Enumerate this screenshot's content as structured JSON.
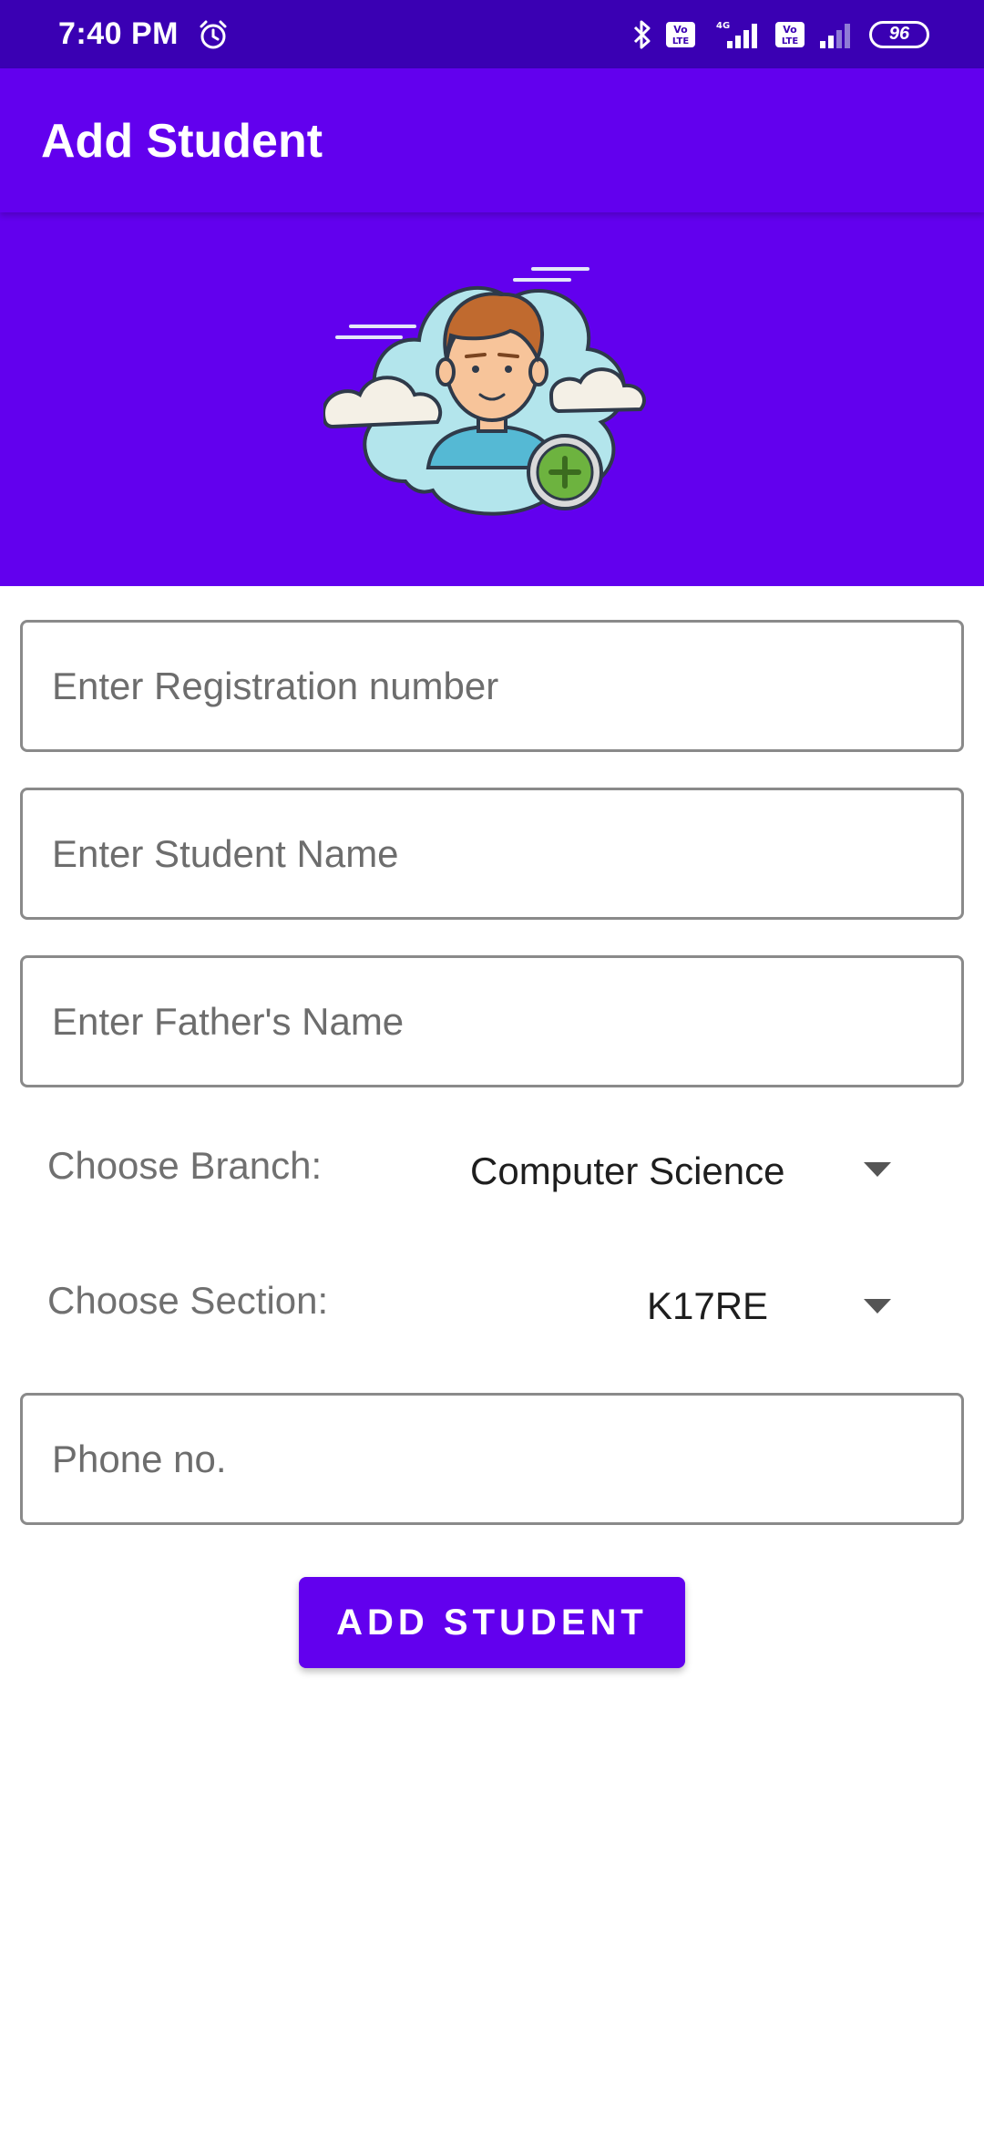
{
  "status_bar": {
    "time": "7:40 PM",
    "battery_level": "96",
    "icons": [
      "alarm-icon",
      "bluetooth-icon",
      "volte-icon",
      "signal-4g-icon",
      "volte-icon",
      "signal-icon",
      "battery-icon"
    ]
  },
  "app_bar": {
    "title": "Add Student"
  },
  "header": {
    "illustration": "student-avatar-add-icon"
  },
  "form": {
    "registration_placeholder": "Enter Registration number",
    "student_name_placeholder": "Enter Student Name",
    "father_name_placeholder": "Enter Father's Name",
    "branch_label": "Choose Branch:",
    "branch_value": "Computer Science",
    "section_label": "Choose Section:",
    "section_value": "K17RE",
    "phone_placeholder": "Phone no.",
    "submit_label": "ADD STUDENT"
  },
  "colors": {
    "primary": "#6200ee",
    "status_bar": "#3a00b3",
    "field_border": "#8a8a8a"
  }
}
